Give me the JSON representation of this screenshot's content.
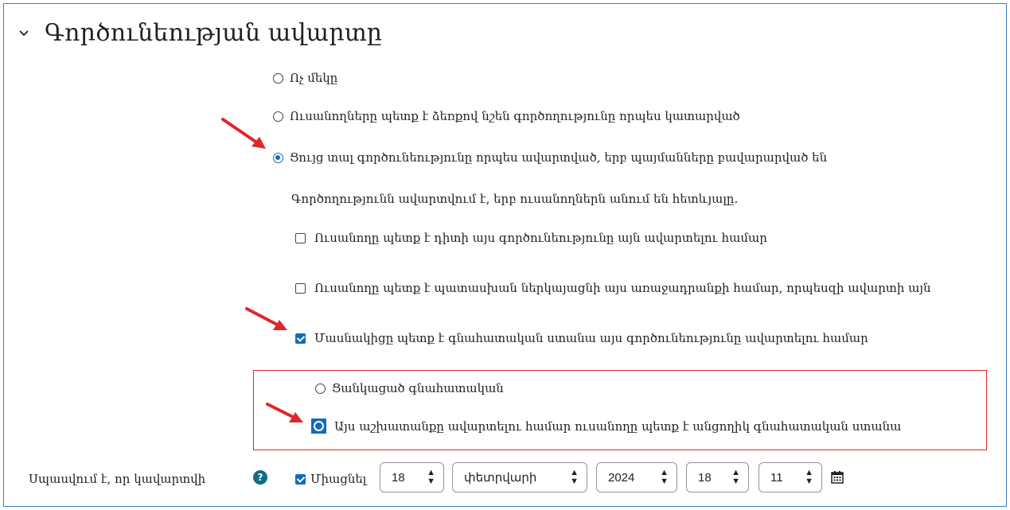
{
  "section": {
    "title": "Գործունեության ավարտը"
  },
  "options": {
    "none": "Ոչ մեկը",
    "manual": "Ուսանողները պետք է ձեռքով նշեն գործողությունը որպես կատարված",
    "auto": "Ցույց տալ գործունեությունը որպես ավարտված, երբ պայմանները բավարարված են"
  },
  "conditions": {
    "intro": "Գործողությունն ավարտվում է, երբ ուսանողներն անում են հետևյալը.",
    "view": "Ուսանողը պետք է դիտի այս գործունեությունը այն ավարտելու համար",
    "submit": "Ուսանողը պետք է պատասխան ներկայացնի այս առաջադրանքի համար, որպեսզի ավարտի այն",
    "grade": "Մասնակիցը պետք է գնահատական ստանա այս գործունեությունը ավարտելու համար",
    "any_grade": "Ցանկացած գնահատական",
    "pass_grade": "Այս աշխատանքը ավարտելու համար ուսանողը պետք է անցողիկ գնահատական ստանա"
  },
  "expected": {
    "label": "Սպասվում է, որ կավարտվի",
    "enable": "Միացնել",
    "day": "18",
    "month": "փետրվարի",
    "year": "2024",
    "hour": "18",
    "minute": "11"
  },
  "state": {
    "completion": "auto",
    "view": false,
    "submit": false,
    "grade": true,
    "grade_type": "pass_grade",
    "expected_enabled": true
  },
  "colors": {
    "accent": "#0f6cbf",
    "frame": "#3a7fc1",
    "highlight": "#e0262b",
    "help": "#0f6e84"
  },
  "icons": [
    "chevron-down-icon",
    "help-icon",
    "calendar-icon",
    "arrow-icon"
  ]
}
